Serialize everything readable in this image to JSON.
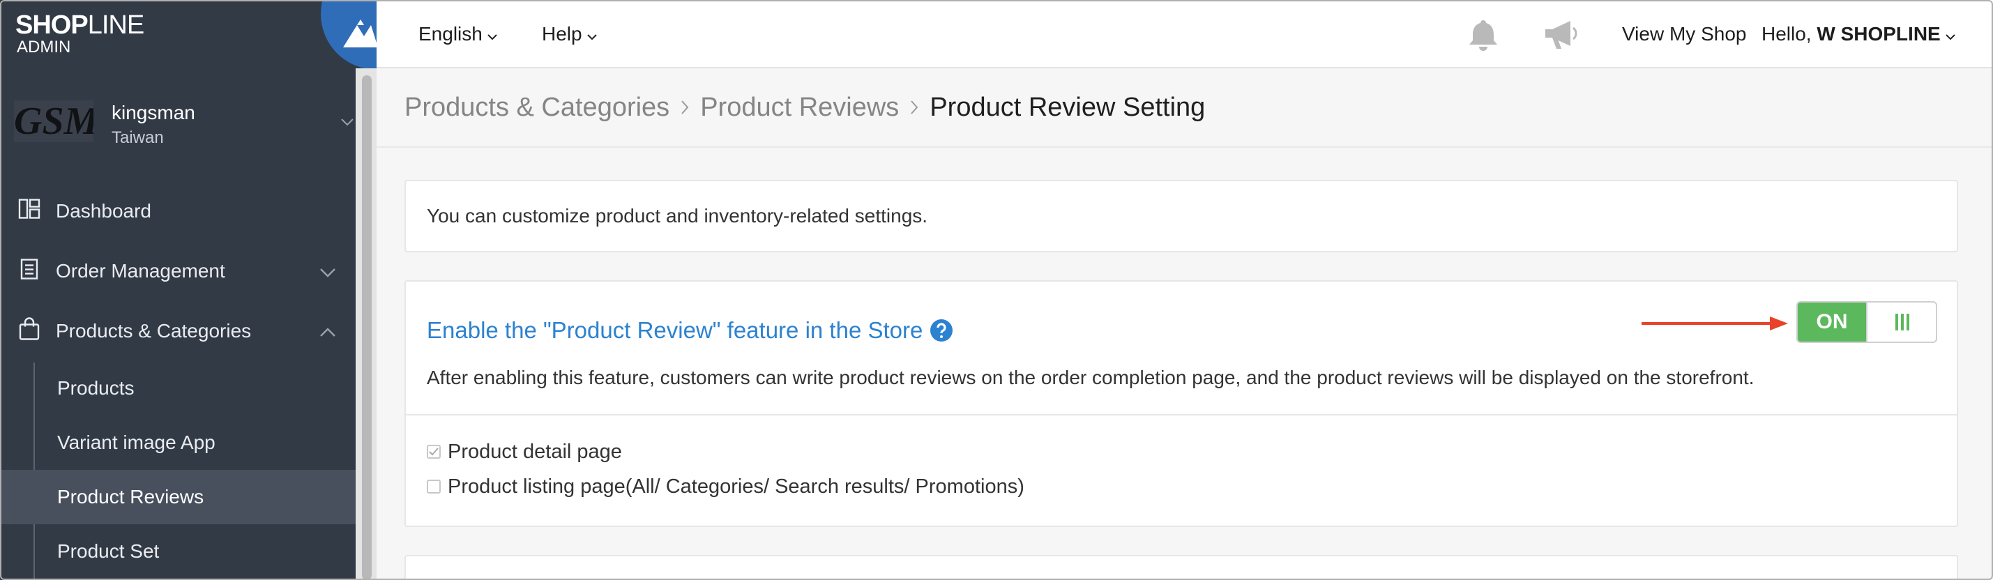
{
  "brand": {
    "logo_bold": "SHOP",
    "logo_thin": "LINE",
    "logo_sub": "ADMIN"
  },
  "store": {
    "logo_text": "GSM",
    "name": "kingsman",
    "region": "Taiwan"
  },
  "sidebar": {
    "items": [
      {
        "label": "Dashboard",
        "icon": "dashboard-icon"
      },
      {
        "label": "Order Management",
        "icon": "order-icon",
        "expanded": false
      },
      {
        "label": "Products & Categories",
        "icon": "bag-icon",
        "expanded": true
      }
    ],
    "subitems": [
      {
        "label": "Products"
      },
      {
        "label": "Variant image App"
      },
      {
        "label": "Product Reviews",
        "active": true
      },
      {
        "label": "Product Set"
      }
    ]
  },
  "topbar": {
    "language": "English",
    "help": "Help",
    "view_shop": "View My Shop",
    "greeting": "Hello, ",
    "user": "W SHOPLINE"
  },
  "breadcrumb": [
    "Products & Categories",
    "Product Reviews",
    "Product Review Setting"
  ],
  "info": {
    "text": "You can customize product and inventory-related settings."
  },
  "feature": {
    "title": "Enable the \"Product Review\" feature in the Store",
    "description": "After enabling this feature, customers can write product reviews on the order completion page, and the product reviews will be displayed on the storefront.",
    "toggle_label": "ON",
    "enabled": true,
    "options": [
      {
        "label": "Product detail page",
        "checked": true
      },
      {
        "label": "Product listing page(All/ Categories/ Search results/ Promotions)",
        "checked": false
      }
    ]
  },
  "colors": {
    "sidebar_bg": "#323a46",
    "accent_blue": "#2c82d1",
    "toggle_green": "#5cb85c",
    "arrow_red": "#e8432a",
    "badge_blue": "#2f6db8"
  }
}
